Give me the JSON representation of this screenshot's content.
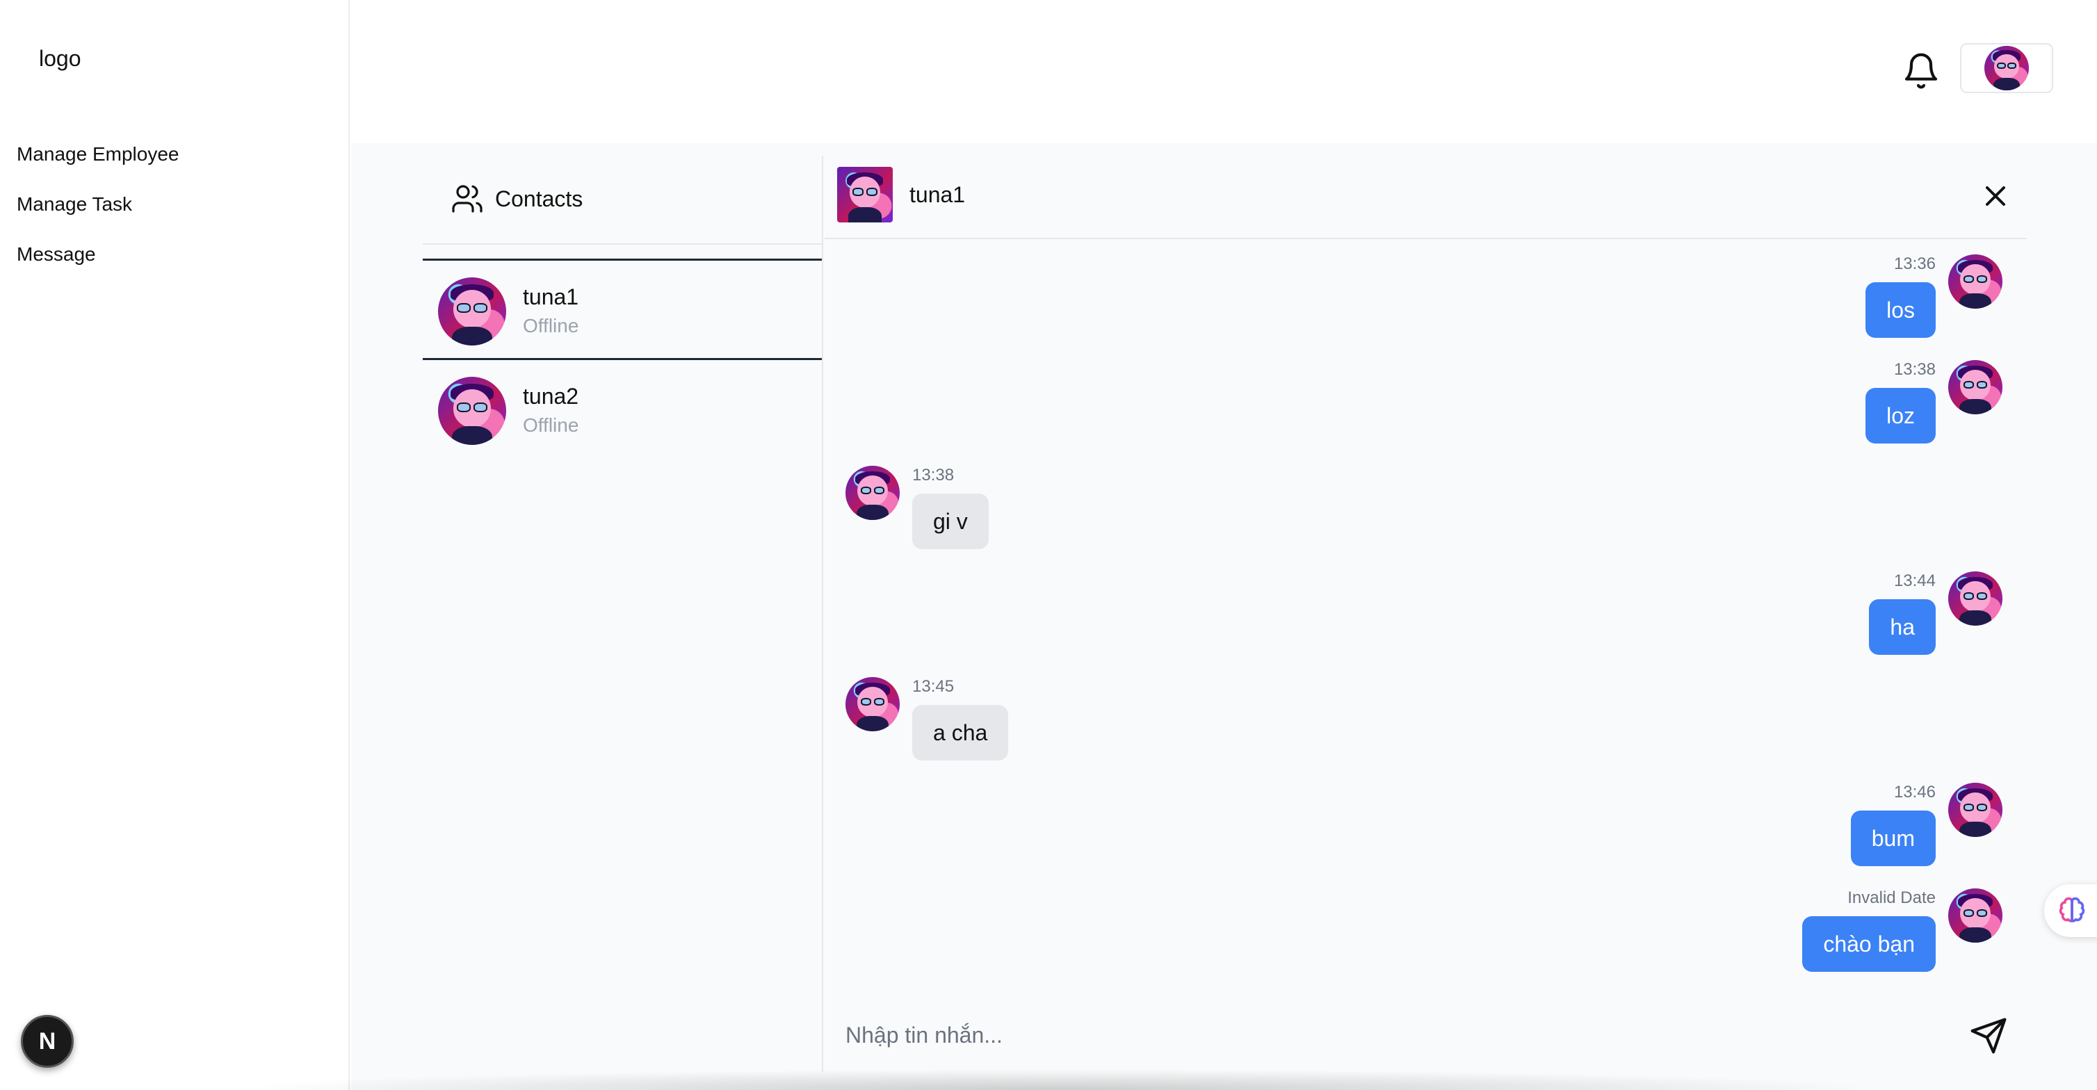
{
  "sidebar": {
    "logo": "logo",
    "items": [
      {
        "label": "Manage Employee"
      },
      {
        "label": "Manage Task"
      },
      {
        "label": "Message"
      }
    ],
    "badge_letter": "N"
  },
  "header": {
    "bell_icon": "bell-icon",
    "avatar_icon": "user-avatar"
  },
  "contacts": {
    "title": "Contacts",
    "icon": "users-icon",
    "list": [
      {
        "name": "tuna1",
        "status": "Offline",
        "active": true
      },
      {
        "name": "tuna2",
        "status": "Offline",
        "active": false
      }
    ]
  },
  "chat": {
    "name": "tuna1",
    "close_icon": "close-icon",
    "messages": [
      {
        "direction": "out",
        "time": "13:36",
        "text": "los"
      },
      {
        "direction": "out",
        "time": "13:38",
        "text": "loz"
      },
      {
        "direction": "in",
        "time": "13:38",
        "text": "gi v"
      },
      {
        "direction": "out",
        "time": "13:44",
        "text": "ha"
      },
      {
        "direction": "in",
        "time": "13:45",
        "text": "a cha"
      },
      {
        "direction": "out",
        "time": "13:46",
        "text": "bum"
      },
      {
        "direction": "out",
        "time": "Invalid Date",
        "text": "chào bạn"
      }
    ],
    "composer": {
      "placeholder": "Nhập tin nhắn...",
      "value": "",
      "send_icon": "send-icon"
    }
  },
  "floating": {
    "icon": "brain-icon"
  },
  "colors": {
    "outgoing_bubble": "#3b82f6",
    "incoming_bubble": "#e5e7eb",
    "main_bg": "#f9fafb"
  }
}
